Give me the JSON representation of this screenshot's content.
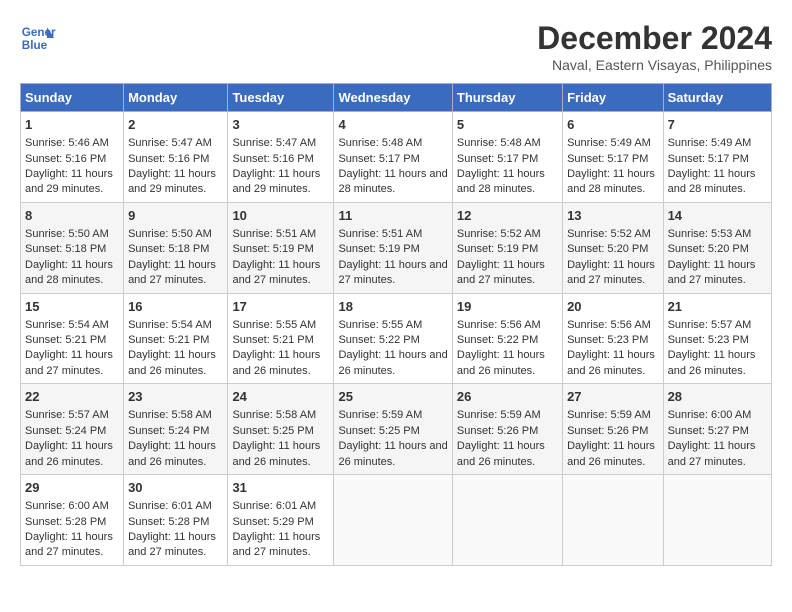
{
  "header": {
    "logo_line1": "General",
    "logo_line2": "Blue",
    "title": "December 2024",
    "subtitle": "Naval, Eastern Visayas, Philippines"
  },
  "columns": [
    "Sunday",
    "Monday",
    "Tuesday",
    "Wednesday",
    "Thursday",
    "Friday",
    "Saturday"
  ],
  "weeks": [
    [
      {
        "day": "1",
        "sunrise": "Sunrise: 5:46 AM",
        "sunset": "Sunset: 5:16 PM",
        "daylight": "Daylight: 11 hours and 29 minutes."
      },
      {
        "day": "2",
        "sunrise": "Sunrise: 5:47 AM",
        "sunset": "Sunset: 5:16 PM",
        "daylight": "Daylight: 11 hours and 29 minutes."
      },
      {
        "day": "3",
        "sunrise": "Sunrise: 5:47 AM",
        "sunset": "Sunset: 5:16 PM",
        "daylight": "Daylight: 11 hours and 29 minutes."
      },
      {
        "day": "4",
        "sunrise": "Sunrise: 5:48 AM",
        "sunset": "Sunset: 5:17 PM",
        "daylight": "Daylight: 11 hours and 28 minutes."
      },
      {
        "day": "5",
        "sunrise": "Sunrise: 5:48 AM",
        "sunset": "Sunset: 5:17 PM",
        "daylight": "Daylight: 11 hours and 28 minutes."
      },
      {
        "day": "6",
        "sunrise": "Sunrise: 5:49 AM",
        "sunset": "Sunset: 5:17 PM",
        "daylight": "Daylight: 11 hours and 28 minutes."
      },
      {
        "day": "7",
        "sunrise": "Sunrise: 5:49 AM",
        "sunset": "Sunset: 5:17 PM",
        "daylight": "Daylight: 11 hours and 28 minutes."
      }
    ],
    [
      {
        "day": "8",
        "sunrise": "Sunrise: 5:50 AM",
        "sunset": "Sunset: 5:18 PM",
        "daylight": "Daylight: 11 hours and 28 minutes."
      },
      {
        "day": "9",
        "sunrise": "Sunrise: 5:50 AM",
        "sunset": "Sunset: 5:18 PM",
        "daylight": "Daylight: 11 hours and 27 minutes."
      },
      {
        "day": "10",
        "sunrise": "Sunrise: 5:51 AM",
        "sunset": "Sunset: 5:19 PM",
        "daylight": "Daylight: 11 hours and 27 minutes."
      },
      {
        "day": "11",
        "sunrise": "Sunrise: 5:51 AM",
        "sunset": "Sunset: 5:19 PM",
        "daylight": "Daylight: 11 hours and 27 minutes."
      },
      {
        "day": "12",
        "sunrise": "Sunrise: 5:52 AM",
        "sunset": "Sunset: 5:19 PM",
        "daylight": "Daylight: 11 hours and 27 minutes."
      },
      {
        "day": "13",
        "sunrise": "Sunrise: 5:52 AM",
        "sunset": "Sunset: 5:20 PM",
        "daylight": "Daylight: 11 hours and 27 minutes."
      },
      {
        "day": "14",
        "sunrise": "Sunrise: 5:53 AM",
        "sunset": "Sunset: 5:20 PM",
        "daylight": "Daylight: 11 hours and 27 minutes."
      }
    ],
    [
      {
        "day": "15",
        "sunrise": "Sunrise: 5:54 AM",
        "sunset": "Sunset: 5:21 PM",
        "daylight": "Daylight: 11 hours and 27 minutes."
      },
      {
        "day": "16",
        "sunrise": "Sunrise: 5:54 AM",
        "sunset": "Sunset: 5:21 PM",
        "daylight": "Daylight: 11 hours and 26 minutes."
      },
      {
        "day": "17",
        "sunrise": "Sunrise: 5:55 AM",
        "sunset": "Sunset: 5:21 PM",
        "daylight": "Daylight: 11 hours and 26 minutes."
      },
      {
        "day": "18",
        "sunrise": "Sunrise: 5:55 AM",
        "sunset": "Sunset: 5:22 PM",
        "daylight": "Daylight: 11 hours and 26 minutes."
      },
      {
        "day": "19",
        "sunrise": "Sunrise: 5:56 AM",
        "sunset": "Sunset: 5:22 PM",
        "daylight": "Daylight: 11 hours and 26 minutes."
      },
      {
        "day": "20",
        "sunrise": "Sunrise: 5:56 AM",
        "sunset": "Sunset: 5:23 PM",
        "daylight": "Daylight: 11 hours and 26 minutes."
      },
      {
        "day": "21",
        "sunrise": "Sunrise: 5:57 AM",
        "sunset": "Sunset: 5:23 PM",
        "daylight": "Daylight: 11 hours and 26 minutes."
      }
    ],
    [
      {
        "day": "22",
        "sunrise": "Sunrise: 5:57 AM",
        "sunset": "Sunset: 5:24 PM",
        "daylight": "Daylight: 11 hours and 26 minutes."
      },
      {
        "day": "23",
        "sunrise": "Sunrise: 5:58 AM",
        "sunset": "Sunset: 5:24 PM",
        "daylight": "Daylight: 11 hours and 26 minutes."
      },
      {
        "day": "24",
        "sunrise": "Sunrise: 5:58 AM",
        "sunset": "Sunset: 5:25 PM",
        "daylight": "Daylight: 11 hours and 26 minutes."
      },
      {
        "day": "25",
        "sunrise": "Sunrise: 5:59 AM",
        "sunset": "Sunset: 5:25 PM",
        "daylight": "Daylight: 11 hours and 26 minutes."
      },
      {
        "day": "26",
        "sunrise": "Sunrise: 5:59 AM",
        "sunset": "Sunset: 5:26 PM",
        "daylight": "Daylight: 11 hours and 26 minutes."
      },
      {
        "day": "27",
        "sunrise": "Sunrise: 5:59 AM",
        "sunset": "Sunset: 5:26 PM",
        "daylight": "Daylight: 11 hours and 26 minutes."
      },
      {
        "day": "28",
        "sunrise": "Sunrise: 6:00 AM",
        "sunset": "Sunset: 5:27 PM",
        "daylight": "Daylight: 11 hours and 27 minutes."
      }
    ],
    [
      {
        "day": "29",
        "sunrise": "Sunrise: 6:00 AM",
        "sunset": "Sunset: 5:28 PM",
        "daylight": "Daylight: 11 hours and 27 minutes."
      },
      {
        "day": "30",
        "sunrise": "Sunrise: 6:01 AM",
        "sunset": "Sunset: 5:28 PM",
        "daylight": "Daylight: 11 hours and 27 minutes."
      },
      {
        "day": "31",
        "sunrise": "Sunrise: 6:01 AM",
        "sunset": "Sunset: 5:29 PM",
        "daylight": "Daylight: 11 hours and 27 minutes."
      },
      null,
      null,
      null,
      null
    ]
  ]
}
